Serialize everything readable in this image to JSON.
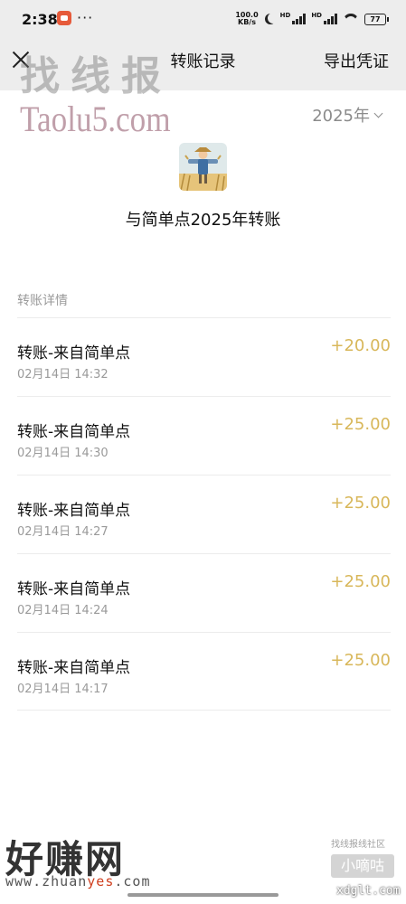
{
  "status_bar": {
    "time": "2:38",
    "more": "···",
    "net_speed_value": "100.0",
    "net_speed_unit": "KB/s",
    "hd1": "HD",
    "hd2": "HD",
    "battery": "77"
  },
  "nav": {
    "title": "转账记录",
    "export_label": "导出凭证"
  },
  "year_selector": {
    "label": "2025年"
  },
  "summary": {
    "title": "与简单点2025年转账"
  },
  "details": {
    "section_label": "转账详情",
    "rows": [
      {
        "title": "转账-来自简单点",
        "time": "02月14日 14:32",
        "amount": "+20.00"
      },
      {
        "title": "转账-来自简单点",
        "time": "02月14日 14:30",
        "amount": "+25.00"
      },
      {
        "title": "转账-来自简单点",
        "time": "02月14日 14:27",
        "amount": "+25.00"
      },
      {
        "title": "转账-来自简单点",
        "time": "02月14日 14:24",
        "amount": "+25.00"
      },
      {
        "title": "转账-来自简单点",
        "time": "02月14日 14:17",
        "amount": "+25.00"
      }
    ]
  },
  "watermarks": {
    "top_cn": "找线报",
    "top_en": "Taolu5.com",
    "bottom_cn": "好赚网",
    "bottom_url_a": "www.zhuan",
    "bottom_url_b": "yes",
    "bottom_url_c": ".com",
    "small_top": "找线报线社区",
    "small_badge": "小嘀咕",
    "small_url": "xdglt.com"
  },
  "colors": {
    "amount": "#d8b75a",
    "header_bg": "#ededed",
    "muted_text": "#9a9a9a"
  }
}
